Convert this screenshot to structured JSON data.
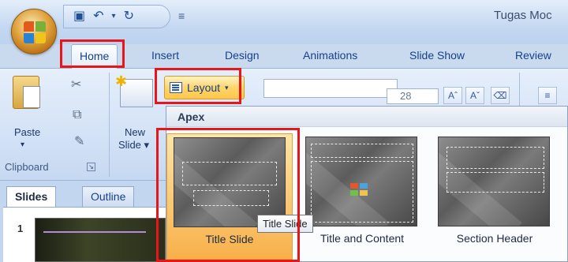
{
  "window": {
    "document_title": "Tugas Moc"
  },
  "quick_access": {
    "save_icon": "save-icon",
    "undo_icon": "undo-icon",
    "redo_icon": "redo-icon",
    "more_icon": "customize-icon"
  },
  "tabs": [
    "Home",
    "Insert",
    "Design",
    "Animations",
    "Slide Show",
    "Review"
  ],
  "ribbon": {
    "clipboard": {
      "paste_label": "Paste",
      "paste_arrow": "▾",
      "group_label": "Clipboard"
    },
    "slides": {
      "new_label_1": "New",
      "new_label_2": "Slide ▾",
      "layout_label": "Layout",
      "layout_arrow": "▾"
    },
    "font": {
      "size_value": "28"
    }
  },
  "layout_gallery": {
    "header": "Apex",
    "items": [
      {
        "label": "Title Slide",
        "selected": true
      },
      {
        "label": "Title and Content",
        "selected": false
      },
      {
        "label": "Section Header",
        "selected": false
      }
    ],
    "tooltip": "Title Slide"
  },
  "slides_pane": {
    "tabs": [
      "Slides",
      "Outline"
    ],
    "slide_number": "1"
  },
  "colors": {
    "highlight": "#e8151b",
    "accent": "#ffc64a",
    "ribbon_text": "#15428b"
  }
}
